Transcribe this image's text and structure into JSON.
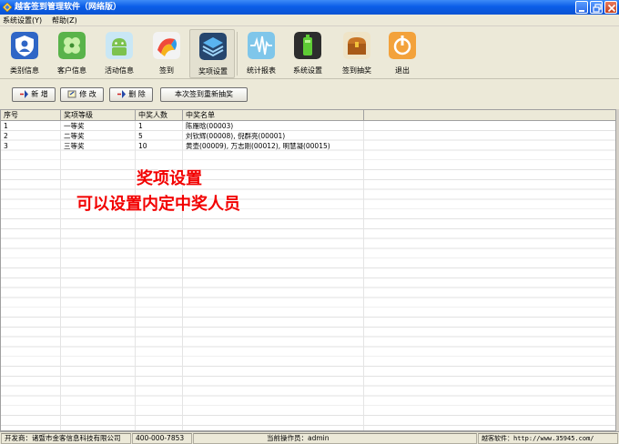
{
  "window": {
    "title": "越客签到管理软件（网络版）"
  },
  "menu": [
    "系统设置(Y)",
    "帮助(Z)"
  ],
  "toolbar": [
    {
      "label": "类别信息",
      "icon": "shield-person-icon"
    },
    {
      "label": "客户信息",
      "icon": "clover-icon"
    },
    {
      "label": "活动信息",
      "icon": "android-icon"
    },
    {
      "label": "签到",
      "icon": "color-ribbon-icon"
    },
    {
      "label": "奖项设置",
      "icon": "layers-icon"
    },
    {
      "label": "统计报表",
      "icon": "waveform-icon"
    },
    {
      "label": "系统设置",
      "icon": "battery-icon"
    },
    {
      "label": "签到抽奖",
      "icon": "treasure-chest-icon"
    },
    {
      "label": "退出",
      "icon": "exit-icon"
    }
  ],
  "actions": {
    "add": "新 增",
    "edit": "修 改",
    "delete": "删 除",
    "redraw": "本次签到重新抽奖"
  },
  "grid": {
    "headers": [
      "序号",
      "奖项等级",
      "中奖人数",
      "中奖名单"
    ],
    "rows": [
      [
        "1",
        "一等奖",
        "1",
        "陈雁晗(00003)"
      ],
      [
        "2",
        "二等奖",
        "5",
        "刘钦辉(00008), 倪群亮(00001)"
      ],
      [
        "3",
        "三等奖",
        "10",
        "黄壶(00009), 万志刚(00012), 明慧凝(00015)"
      ]
    ]
  },
  "annotation": {
    "line1": "奖项设置",
    "line2": "可以设置内定中奖人员"
  },
  "status": {
    "developer": "开发商：诸暨市金客信息科技有限公司",
    "phone": "400-000-7853",
    "operator": "当前操作员：admin",
    "site": "越客软件：http://www.35945.com/"
  },
  "colors": {
    "title_bar": "#0b5ee8",
    "annotation": "#f20000",
    "face": "#ece9d8"
  }
}
